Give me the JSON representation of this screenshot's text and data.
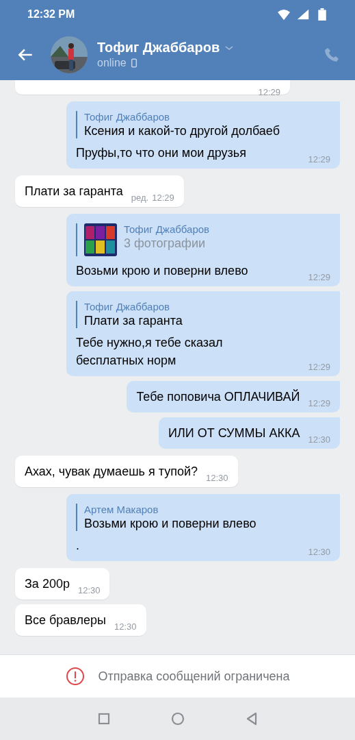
{
  "status_bar": {
    "time": "12:32 PM"
  },
  "header": {
    "name": "Тофиг Джаббаров",
    "status": "online"
  },
  "messages": [
    {
      "outgoing": false,
      "partial": true,
      "time": "12:29"
    },
    {
      "outgoing": true,
      "reply": {
        "author": "Тофиг Джаббаров",
        "text": "Ксения  и какой-то другой долбаеб"
      },
      "text": "Пруфы,то что они мои друзья",
      "time": "12:29"
    },
    {
      "outgoing": false,
      "text": "Плати за гаранта",
      "edited": "ред.",
      "time": "12:29"
    },
    {
      "outgoing": true,
      "reply": {
        "author": "Тофиг Джаббаров",
        "attachment": "3 фотографии"
      },
      "text": "Возьми крою и поверни влево",
      "time": "12:29"
    },
    {
      "outgoing": true,
      "reply": {
        "author": "Тофиг Джаббаров",
        "text": "Плати за гаранта"
      },
      "text": "Тебе нужно,я тебе сказал\nбесплатных норм",
      "time": "12:29"
    },
    {
      "outgoing": true,
      "text": "Тебе поповича ОПЛАЧИВАЙ",
      "time": "12:29"
    },
    {
      "outgoing": true,
      "text": "ИЛИ ОТ СУММЫ АККА",
      "time": "12:30"
    },
    {
      "outgoing": false,
      "text": "Ахах, чувак думаешь я тупой?",
      "time": "12:30"
    },
    {
      "outgoing": true,
      "reply": {
        "author": "Артем Макаров",
        "text": "Возьми крою и поверни влево"
      },
      "text": ".",
      "time": "12:30"
    },
    {
      "outgoing": false,
      "text": "За 200р",
      "time": "12:30"
    },
    {
      "outgoing": false,
      "text": "Все бравлеры",
      "time": "12:30"
    }
  ],
  "restriction": {
    "text": "Отправка сообщений ограничена"
  }
}
